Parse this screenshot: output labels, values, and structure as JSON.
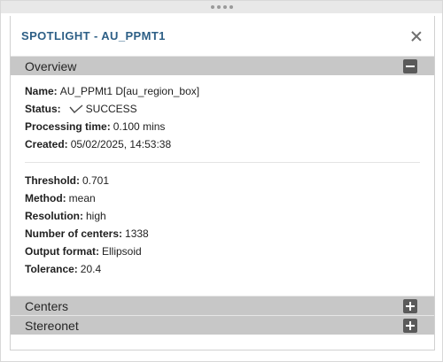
{
  "panel": {
    "title": "SPOTLIGHT - AU_PPMT1"
  },
  "sections": {
    "overview": {
      "label": "Overview"
    },
    "centers": {
      "label": "Centers"
    },
    "stereonet": {
      "label": "Stereonet"
    }
  },
  "overview": {
    "name": {
      "label": "Name:",
      "value": "AU_PPMt1 D[au_region_box]"
    },
    "status": {
      "label": "Status:",
      "value": "SUCCESS",
      "icon": "check-icon"
    },
    "processing_time": {
      "label": "Processing time:",
      "value": "0.100 mins"
    },
    "created": {
      "label": "Created:",
      "value": "05/02/2025, 14:53:38"
    },
    "threshold": {
      "label": "Threshold:",
      "value": "0.701"
    },
    "method": {
      "label": "Method:",
      "value": "mean"
    },
    "resolution": {
      "label": "Resolution:",
      "value": "high"
    },
    "number_of_centers": {
      "label": "Number of centers:",
      "value": "1338"
    },
    "output_format": {
      "label": "Output format:",
      "value": "Ellipsoid"
    },
    "tolerance": {
      "label": "Tolerance:",
      "value": "20.4"
    }
  },
  "colors": {
    "title": "#2d5f86",
    "section_header": "#c7c7c7",
    "toggle_icon": "#5a5a5a"
  }
}
